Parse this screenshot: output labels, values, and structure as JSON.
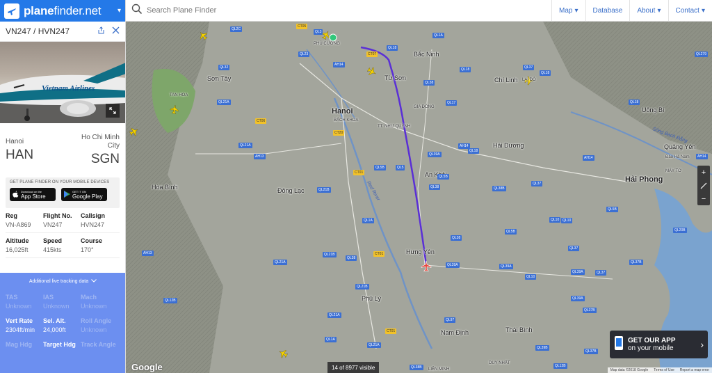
{
  "app": {
    "brand_bold": "plane",
    "brand_rest": "finder.net"
  },
  "flight": {
    "id": "VN247 / HVN247",
    "origin": {
      "city": "Hanoi",
      "code": "HAN"
    },
    "destination": {
      "city": "Ho Chi Minh City",
      "code": "SGN"
    },
    "airline_livery": "Vietnam Airlines"
  },
  "promo": {
    "text": "GET PLANE FINDER ON YOUR MOBILE DEVICES",
    "appstore_small": "Download on the",
    "appstore_big": "App Store",
    "play_small": "GET IT ON",
    "play_big": "Google Play"
  },
  "details": [
    [
      {
        "label": "Reg",
        "value": "VN-A869"
      },
      {
        "label": "Flight No.",
        "value": "VN247"
      },
      {
        "label": "Callsign",
        "value": "HVN247"
      }
    ],
    [
      {
        "label": "Altitude",
        "value": "16,025ft"
      },
      {
        "label": "Speed",
        "value": "415kts"
      },
      {
        "label": "Course",
        "value": "170°"
      }
    ]
  ],
  "extra": {
    "header": "Additional live tracking data",
    "rows": [
      [
        {
          "label": "TAS",
          "value": "Unknown",
          "dim": true
        },
        {
          "label": "IAS",
          "value": "Unknown",
          "dim": true
        },
        {
          "label": "Mach",
          "value": "Unknown",
          "dim": true
        }
      ],
      [
        {
          "label": "Vert Rate",
          "value": "2304ft/min",
          "dim": false
        },
        {
          "label": "Sel. Alt.",
          "value": "24,000ft",
          "dim": false
        },
        {
          "label": "Roll Angle",
          "value": "Unknown",
          "dim": true
        }
      ],
      [
        {
          "label": "Mag Hdg",
          "value": "",
          "dim": true
        },
        {
          "label": "Target Hdg",
          "value": "",
          "dim": false
        },
        {
          "label": "Track Angle",
          "value": "",
          "dim": true
        }
      ]
    ]
  },
  "topbar": {
    "search_placeholder": "Search Plane Finder",
    "nav": [
      "Map",
      "Database",
      "About",
      "Contact"
    ]
  },
  "map": {
    "cities": [
      {
        "name": "Bắc Ninh",
        "cls": ""
      },
      {
        "name": "Sơn Tây",
        "cls": ""
      },
      {
        "name": "Từ Sơn",
        "cls": ""
      },
      {
        "name": "Chí Linh",
        "cls": ""
      },
      {
        "name": "Hanoi",
        "cls": "big"
      },
      {
        "name": "BÁCH KHOA",
        "cls": "small"
      },
      {
        "name": "TT. NHƯ QUỲNH",
        "cls": "small"
      },
      {
        "name": "GIA ĐÔNG",
        "cls": "small"
      },
      {
        "name": "Uông Bí",
        "cls": ""
      },
      {
        "name": "Hải Dương",
        "cls": ""
      },
      {
        "name": "Quảng Yên",
        "cls": ""
      },
      {
        "name": "Đảo Hà Nam",
        "cls": "small"
      },
      {
        "name": "Hải Phong",
        "cls": "big"
      },
      {
        "name": "MÁY TƠ",
        "cls": "small"
      },
      {
        "name": "Hòa Bình",
        "cls": ""
      },
      {
        "name": "Đông Lạc",
        "cls": ""
      },
      {
        "name": "An Khải",
        "cls": ""
      },
      {
        "name": "Hưng Yên",
        "cls": ""
      },
      {
        "name": "Phủ Lý",
        "cls": ""
      },
      {
        "name": "Thái Bình",
        "cls": ""
      },
      {
        "name": "Nam Định",
        "cls": ""
      },
      {
        "name": "PHÚ CƯỜNG",
        "cls": "small"
      },
      {
        "name": "TAN HOA",
        "cls": "small"
      },
      {
        "name": "LIÊN MINH",
        "cls": "small"
      },
      {
        "name": "DUY NHẤT",
        "cls": "small"
      },
      {
        "name": "LẠI ĐÔ",
        "cls": "small"
      }
    ],
    "roads": [
      {
        "name": "QL2C",
        "c": ""
      },
      {
        "name": "CT05",
        "c": "yel"
      },
      {
        "name": "QL1A",
        "c": ""
      },
      {
        "name": "QL23",
        "c": ""
      },
      {
        "name": "QL3",
        "c": ""
      },
      {
        "name": "CT07",
        "c": "yel"
      },
      {
        "name": "QL18",
        "c": ""
      },
      {
        "name": "QL32",
        "c": ""
      },
      {
        "name": "AH14",
        "c": ""
      },
      {
        "name": "QL18",
        "c": ""
      },
      {
        "name": "QL37",
        "c": ""
      },
      {
        "name": "QL18",
        "c": ""
      },
      {
        "name": "QL38",
        "c": ""
      },
      {
        "name": "QL21A",
        "c": ""
      },
      {
        "name": "QL17",
        "c": ""
      },
      {
        "name": "QL18",
        "c": ""
      },
      {
        "name": "CT06",
        "c": "yel"
      },
      {
        "name": "CT20",
        "c": "yel"
      },
      {
        "name": "QL5",
        "c": ""
      },
      {
        "name": "QL18",
        "c": ""
      },
      {
        "name": "QL21A",
        "c": ""
      },
      {
        "name": "AH13",
        "c": ""
      },
      {
        "name": "QL39A",
        "c": ""
      },
      {
        "name": "AH14",
        "c": ""
      },
      {
        "name": "AH14",
        "c": ""
      },
      {
        "name": "CT01",
        "c": "yel"
      },
      {
        "name": "QL5B",
        "c": ""
      },
      {
        "name": "QL5B",
        "c": ""
      },
      {
        "name": "QL21B",
        "c": ""
      },
      {
        "name": "QL38",
        "c": ""
      },
      {
        "name": "QL38B",
        "c": ""
      },
      {
        "name": "QL37",
        "c": ""
      },
      {
        "name": "QL10",
        "c": ""
      },
      {
        "name": "QL5B",
        "c": ""
      },
      {
        "name": "QL1A",
        "c": ""
      },
      {
        "name": "QL38",
        "c": ""
      },
      {
        "name": "QL21B",
        "c": ""
      },
      {
        "name": "QL38",
        "c": ""
      },
      {
        "name": "CT01",
        "c": "yel"
      },
      {
        "name": "QL39A",
        "c": ""
      },
      {
        "name": "QL39A",
        "c": ""
      },
      {
        "name": "QL37",
        "c": ""
      },
      {
        "name": "QL10",
        "c": ""
      },
      {
        "name": "QL39A",
        "c": ""
      },
      {
        "name": "QL21A",
        "c": ""
      },
      {
        "name": "QL21B",
        "c": ""
      },
      {
        "name": "QL12B",
        "c": ""
      },
      {
        "name": "QL21A",
        "c": ""
      },
      {
        "name": "QL1A",
        "c": ""
      },
      {
        "name": "QL21A",
        "c": ""
      },
      {
        "name": "QL97",
        "c": ""
      },
      {
        "name": "CT01",
        "c": "yel"
      },
      {
        "name": "QL37B",
        "c": ""
      },
      {
        "name": "QL39B",
        "c": ""
      },
      {
        "name": "QL37B",
        "c": ""
      },
      {
        "name": "QL12B",
        "c": ""
      },
      {
        "name": "QL38B",
        "c": ""
      },
      {
        "name": "QL10",
        "c": ""
      },
      {
        "name": "AH13",
        "c": ""
      },
      {
        "name": "QL279",
        "c": ""
      },
      {
        "name": "QL39A",
        "c": ""
      },
      {
        "name": "QL37",
        "c": ""
      },
      {
        "name": "QL5B",
        "c": ""
      },
      {
        "name": "QL37B",
        "c": ""
      },
      {
        "name": "QL20B",
        "c": ""
      },
      {
        "name": "AH14",
        "c": ""
      }
    ],
    "water": [
      "Red River",
      "Sông Bạch Đằng"
    ],
    "visible_count": "14 of 8977 visible",
    "google": "Google",
    "getapp_l1": "GET OUR APP",
    "getapp_l2": "on your mobile",
    "attribution": [
      "Map data ©2018 Google",
      "Terms of Use",
      "Report a map error"
    ],
    "zoom_in": "+",
    "zoom_out": "−"
  },
  "colors": {
    "brand": "#2479e8",
    "route_green": "#31c77a",
    "extra_bg": "#6c8ff0",
    "flight_path": "#5a2fd6",
    "selected_plane": "#e8463b"
  }
}
